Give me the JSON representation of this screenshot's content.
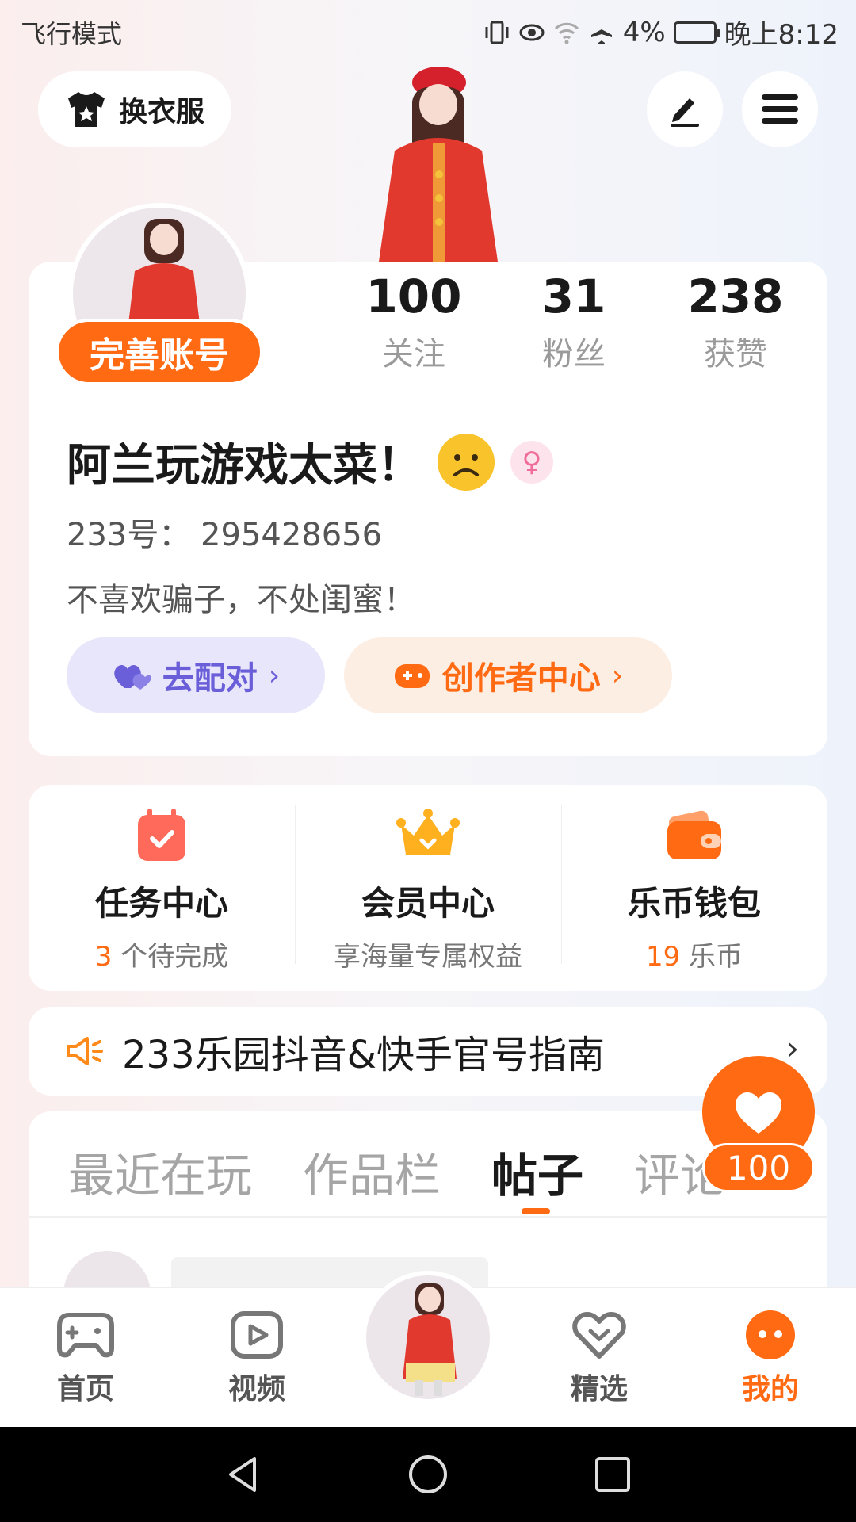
{
  "status_bar": {
    "mode": "飞行模式",
    "battery": "4%",
    "time": "晚上8:12"
  },
  "top": {
    "dress_label": "换衣服"
  },
  "profile": {
    "complete_label": "完善账号",
    "stats": [
      {
        "num": "100",
        "label": "关注"
      },
      {
        "num": "31",
        "label": "粉丝"
      },
      {
        "num": "238",
        "label": "获赞"
      }
    ],
    "username": "阿兰玩游戏太菜！",
    "user_id": "233号：  295428656",
    "bio": "不喜欢骗子，不处闺蜜！",
    "match_label": "去配对",
    "creator_label": "创作者中心"
  },
  "services": [
    {
      "title": "任务中心",
      "num": "3",
      "sub": " 个待完成"
    },
    {
      "title": "会员中心",
      "num": "",
      "sub": "享海量专属权益"
    },
    {
      "title": "乐币钱包",
      "num": "19",
      "sub": " 乐币"
    }
  ],
  "notice": {
    "text": "233乐园抖音&快手官号指南"
  },
  "tabs": [
    "最近在玩",
    "作品栏",
    "帖子",
    "评论"
  ],
  "float_like": {
    "count": "100"
  },
  "bottom_nav": [
    "首页",
    "视频",
    "精选",
    "我的"
  ],
  "colors": {
    "accent": "#ff6a13",
    "match": "#6a5fd9"
  }
}
